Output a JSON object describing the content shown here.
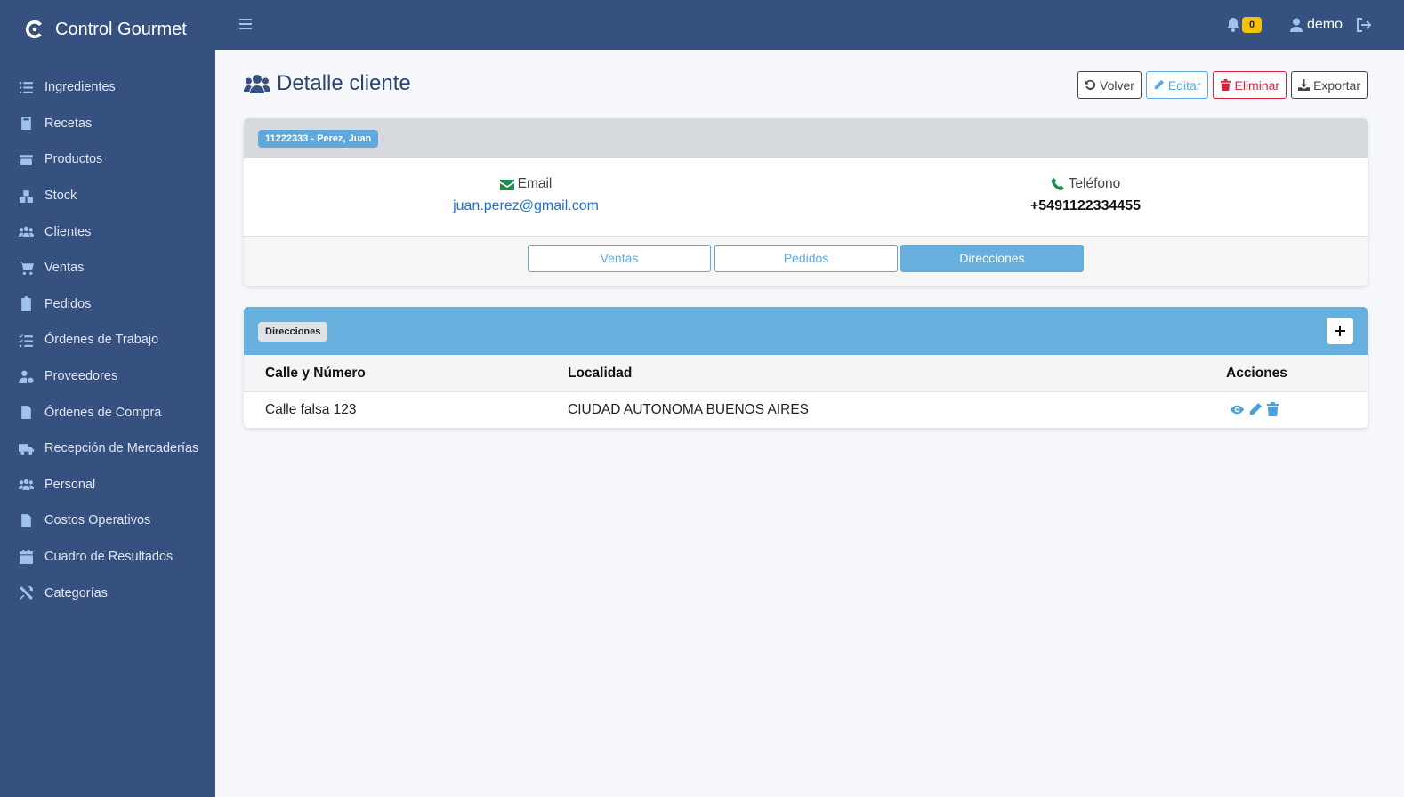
{
  "app": {
    "title": "Control Gourmet"
  },
  "sidebar": {
    "items": [
      {
        "label": "Ingredientes",
        "icon": "list-icon"
      },
      {
        "label": "Recetas",
        "icon": "book-icon"
      },
      {
        "label": "Productos",
        "icon": "box-icon"
      },
      {
        "label": "Stock",
        "icon": "boxes-icon"
      },
      {
        "label": "Clientes",
        "icon": "users-icon"
      },
      {
        "label": "Ventas",
        "icon": "cart-icon"
      },
      {
        "label": "Pedidos",
        "icon": "clipboard-icon"
      },
      {
        "label": "Órdenes de Trabajo",
        "icon": "tasks-icon"
      },
      {
        "label": "Proveedores",
        "icon": "user-cog-icon"
      },
      {
        "label": "Órdenes de Compra",
        "icon": "file-icon"
      },
      {
        "label": "Recepción de Mercaderías",
        "icon": "truck-icon"
      },
      {
        "label": "Personal",
        "icon": "users-icon"
      },
      {
        "label": "Costos Operativos",
        "icon": "invoice-icon"
      },
      {
        "label": "Cuadro de Resultados",
        "icon": "calendar-icon"
      },
      {
        "label": "Categorías",
        "icon": "tools-icon"
      }
    ]
  },
  "topbar": {
    "notifications": "0",
    "user": "demo"
  },
  "page": {
    "title": "Detalle cliente",
    "actions": {
      "back": "Volver",
      "edit": "Editar",
      "delete": "Eliminar",
      "export": "Exportar"
    }
  },
  "client": {
    "badge": "11222333 - Perez, Juan",
    "email_label": "Email",
    "email": "juan.perez@gmail.com",
    "phone_label": "Teléfono",
    "phone": "+5491122334455"
  },
  "tabs": [
    {
      "label": "Ventas",
      "active": false
    },
    {
      "label": "Pedidos",
      "active": false
    },
    {
      "label": "Direcciones",
      "active": true
    }
  ],
  "addresses": {
    "badge": "Direcciones",
    "columns": [
      "Calle y Número",
      "Localidad",
      "Acciones"
    ],
    "rows": [
      {
        "street": "Calle falsa 123",
        "locality": "CIUDAD AUTONOMA BUENOS AIRES"
      }
    ]
  },
  "colors": {
    "sidebar": "#36517f",
    "accent": "#5fa8dd",
    "danger": "#d9233c",
    "badge_yellow": "#f5c20b",
    "success_icon": "#1e8a4c"
  }
}
